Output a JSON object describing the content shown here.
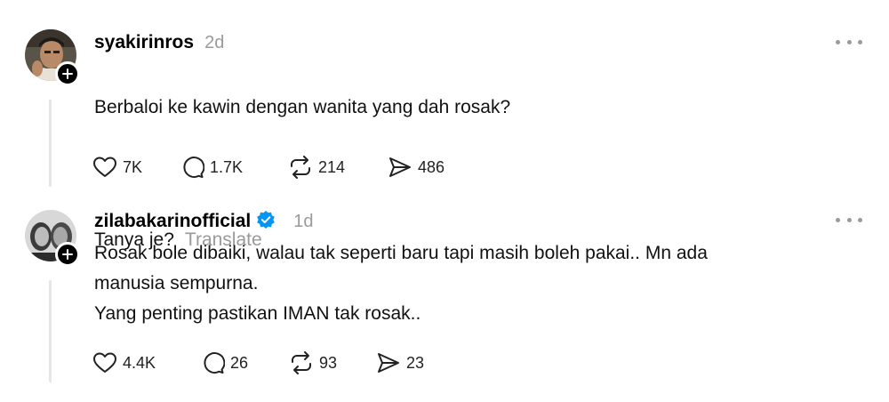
{
  "posts": [
    {
      "username": "syakirinros",
      "time": "2d",
      "verified": false,
      "lines": [
        "Berbaloi ke kawin dengan wanita yang dah rosak?",
        "",
        "Tanya je?"
      ],
      "question": "Berbaloi ke kawin dengan wanita yang dah rosak?",
      "followup": "Tanya je?",
      "translate_label": "Translate",
      "likes": "7K",
      "replies": "1.7K",
      "reposts": "214",
      "shares": "486"
    },
    {
      "username": "zilabakarinofficial",
      "time": "1d",
      "verified": true,
      "text": "Rosak bole dibaiki, walau tak seperti baru tapi masih boleh pakai.. Mn ada\nmanusia sempurna.\nYang penting pastikan IMAN tak rosak..",
      "likes": "4.4K",
      "replies": "26",
      "reposts": "93",
      "shares": "23"
    }
  ],
  "colors": {
    "muted": "#9a9a9a",
    "verified": "#0095f6",
    "thread_line": "#e6e6e6"
  },
  "icons": [
    "heart-icon",
    "comment-icon",
    "repost-icon",
    "share-icon",
    "more-icon",
    "plus-icon",
    "verified-icon"
  ]
}
